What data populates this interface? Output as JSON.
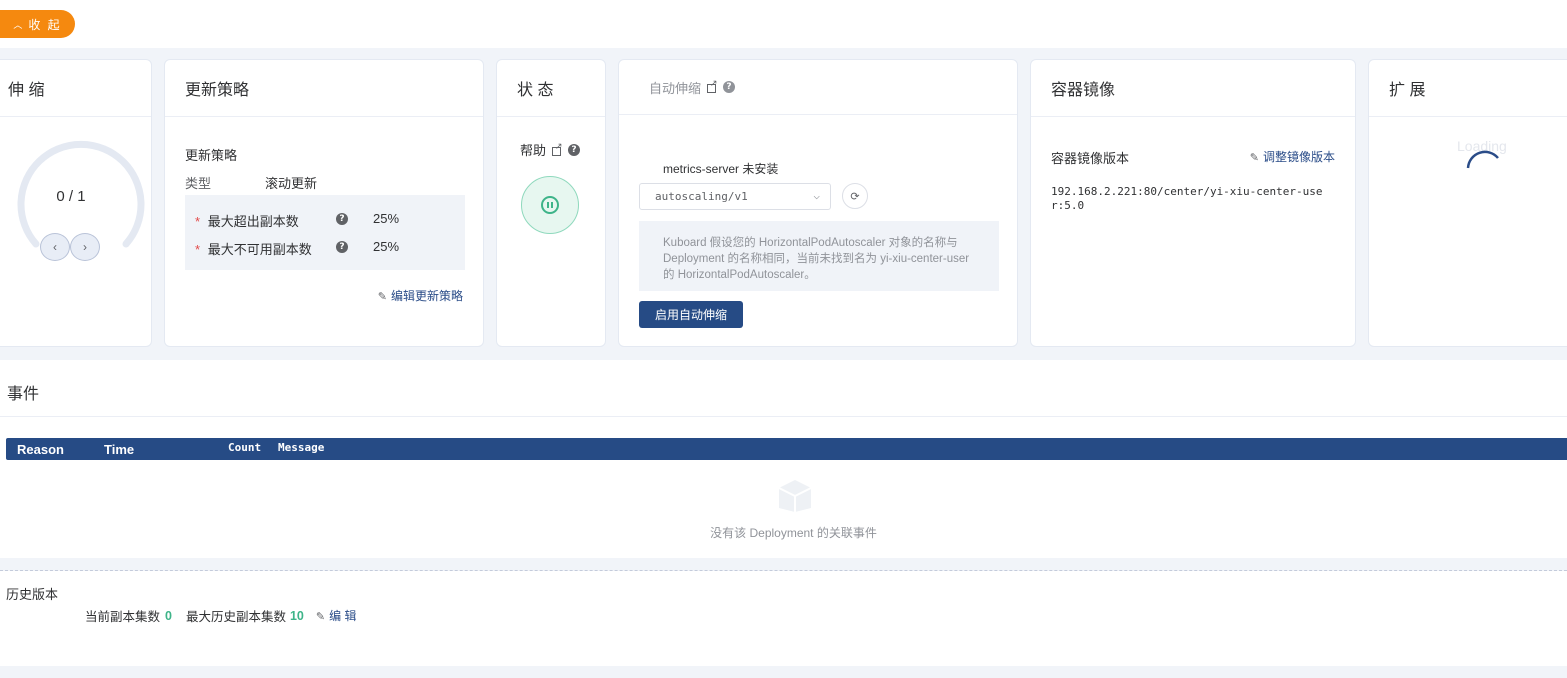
{
  "collapse_label": "收 起",
  "scale": {
    "title": "伸 缩",
    "value": "0 / 1"
  },
  "strategy": {
    "title": "更新策略",
    "subtitle": "更新策略",
    "type_label": "类型",
    "type_value": "滚动更新",
    "rows": [
      {
        "label": "最大超出副本数",
        "value": "25%"
      },
      {
        "label": "最大不可用副本数",
        "value": "25%"
      }
    ],
    "required_mark": "*",
    "edit_label": "编辑更新策略"
  },
  "status": {
    "title": "状 态",
    "help_label": "帮助"
  },
  "autoscale": {
    "title": "自动伸缩",
    "metrics_text": "metrics-server 未安装",
    "api_select_value": "autoscaling/v1",
    "notice": "Kuboard 假设您的 HorizontalPodAutoscaler 对象的名称与 Deployment 的名称相同，当前未找到名为 yi-xiu-center-user 的 HorizontalPodAutoscaler。",
    "enable_button": "启用自动伸缩"
  },
  "image": {
    "title": "容器镜像",
    "version_label": "容器镜像版本",
    "adjust_label": "调整镜像版本",
    "image_value": "192.168.2.221:80/center/yi-xiu-center-user:5.0"
  },
  "extension": {
    "title": "扩 展",
    "loading_text": "Loading"
  },
  "events": {
    "title": "事件",
    "columns": [
      "Reason",
      "Time",
      "Count",
      "Message"
    ],
    "empty_text": "没有该 Deployment 的关联事件"
  },
  "history": {
    "title": "历史版本",
    "current_label": "当前副本集数",
    "current_value": "0",
    "max_label": "最大历史副本集数",
    "max_value": "10",
    "edit_label": "编 辑"
  },
  "colors": {
    "accent": "#264b85",
    "orange": "#f5890f",
    "green": "#3eb489",
    "band": "#f1f4f9"
  }
}
